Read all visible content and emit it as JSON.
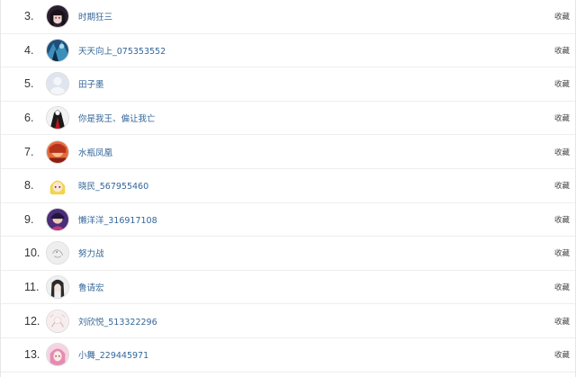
{
  "ranking": {
    "action_label": "收藏",
    "rows": [
      {
        "rank": "3.",
        "name": "时期狂三",
        "avatar_icon": "anime-girl-dark-avatar-icon"
      },
      {
        "rank": "4.",
        "name": "天天向上_075353552",
        "avatar_icon": "blue-abstract-avatar-icon"
      },
      {
        "rank": "5.",
        "name": "田子墨",
        "avatar_icon": "default-user-avatar-icon"
      },
      {
        "rank": "6.",
        "name": "你是我王、偏让我亡",
        "avatar_icon": "red-white-figure-avatar-icon"
      },
      {
        "rank": "7.",
        "name": "水瓶凤凰",
        "avatar_icon": "red-orange-avatar-icon"
      },
      {
        "rank": "8.",
        "name": "晓民_567955460",
        "avatar_icon": "blonde-anime-avatar-icon"
      },
      {
        "rank": "9.",
        "name": "懒洋洋_316917108",
        "avatar_icon": "purple-character-avatar-icon"
      },
      {
        "rank": "10.",
        "name": "努力战",
        "avatar_icon": "sketch-drawing-avatar-icon"
      },
      {
        "rank": "11.",
        "name": "鲁请宏",
        "avatar_icon": "dark-hair-avatar-icon"
      },
      {
        "rank": "12.",
        "name": "刘欣悦_513322296",
        "avatar_icon": "pale-illustration-avatar-icon"
      },
      {
        "rank": "13.",
        "name": "小舞_229445971",
        "avatar_icon": "pink-anime-avatar-icon"
      }
    ]
  }
}
